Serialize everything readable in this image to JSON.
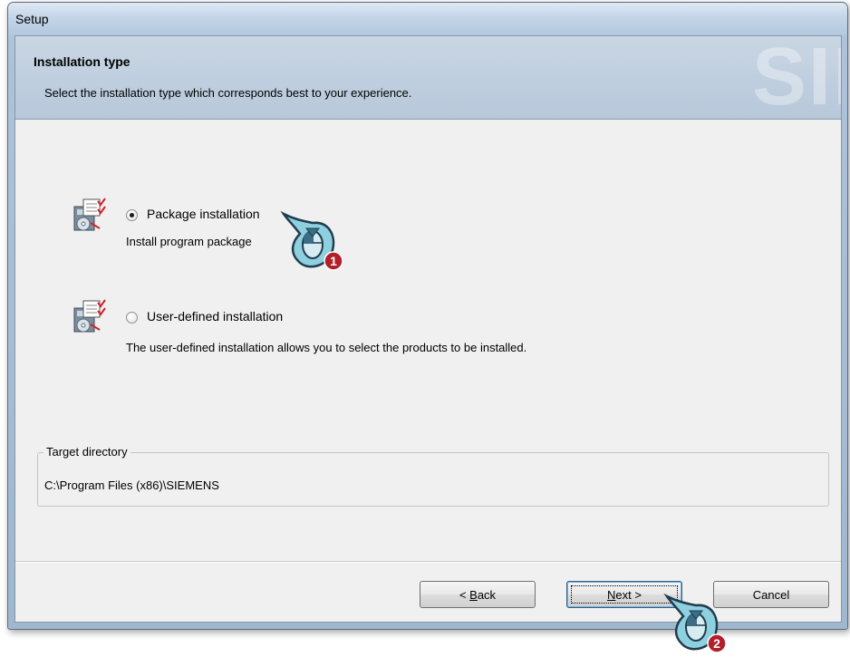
{
  "window": {
    "title": "Setup"
  },
  "header": {
    "title": "Installation type",
    "subtitle": "Select the installation type which corresponds best to your experience.",
    "watermark": "SII"
  },
  "options": [
    {
      "label": "Package installation",
      "description": "Install program package",
      "selected": true
    },
    {
      "label": "User-defined installation",
      "description": "The user-defined installation allows you to select the products to be installed.",
      "selected": false
    }
  ],
  "target_directory": {
    "legend": "Target directory",
    "path": "C:\\Program Files (x86)\\SIEMENS"
  },
  "buttons": {
    "back": {
      "prefix": "< ",
      "mnemonic": "B",
      "rest": "ack"
    },
    "next": {
      "mnemonic": "N",
      "rest": "ext >"
    },
    "cancel": "Cancel"
  },
  "callouts": {
    "step1": "1",
    "step2": "2"
  },
  "colors": {
    "callout_fill": "#8ecfe0",
    "callout_dark": "#1f3d4d",
    "radio_dot": "#1b1b1b"
  }
}
